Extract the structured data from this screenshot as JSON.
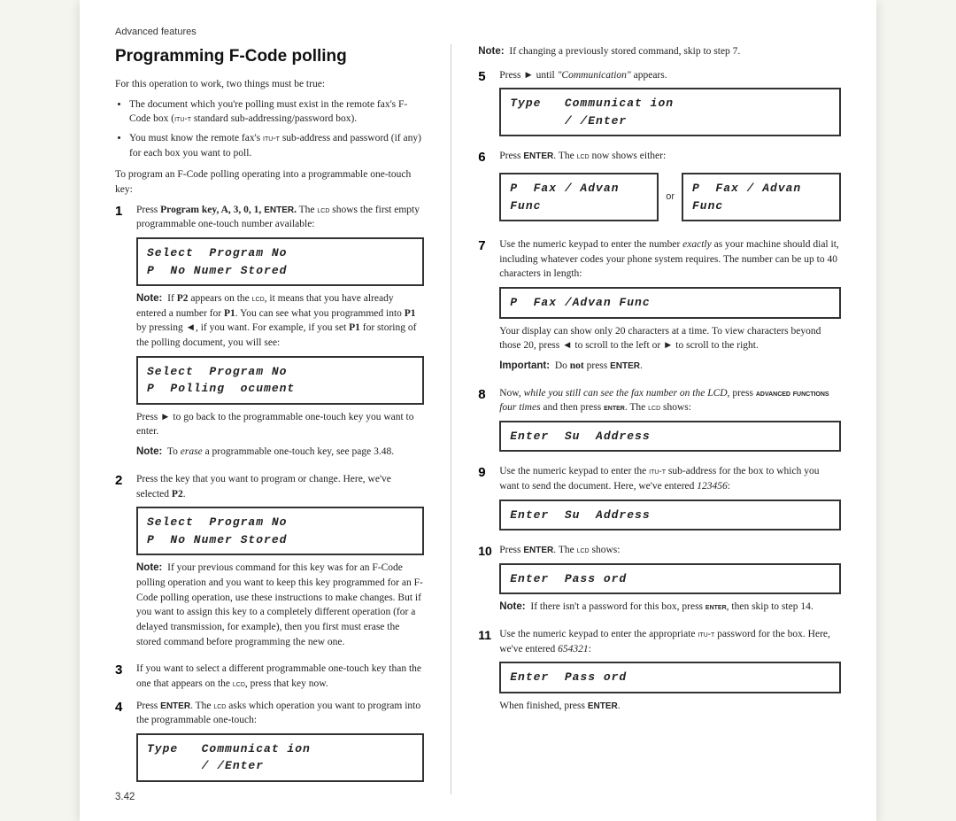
{
  "page": {
    "advanced_features_label": "Advanced features",
    "page_number": "3.42",
    "title": "Programming F-Code polling",
    "intro": "For this operation to work, two things must be true:",
    "bullets": [
      "The document which you're polling must exist in the remote fax's F-Code box (ITU-T standard sub-addressing/password box).",
      "You must know the remote fax's ITU-T sub-address and password (if any) for each box you want to poll."
    ],
    "to_program_text": "To program an F-Code polling operating into a programmable one-touch key:",
    "steps_left": [
      {
        "num": "1",
        "text": "Press Program key, A, 3, 0, 1, ENTER. The LCD shows the first empty programmable one-touch number available:",
        "lcd": [
          "Select  Program No",
          "P  No Numer Stored"
        ],
        "note": "If P2 appears on the LCD, it means that you have already entered a number for P1. You can see what you programmed into P1 by pressing ◄, if you want. For example, if you set P1 for storing of the polling document, you will see:",
        "note_lcd": [
          "Select  Program No",
          "P  Polling  ocument"
        ],
        "note_after": "Press ► to go back to the programmable one-touch key you want to enter.",
        "note2": "To erase a programmable one-touch key, see page 3.48."
      },
      {
        "num": "2",
        "text": "Press the key that you want to program or change. Here, we've selected P2.",
        "lcd": [
          "Select  Program No",
          "P  No Numer Stored"
        ],
        "note": "If your previous command for this key was for an F-Code polling operation and you want to keep this key programmed for an F-Code polling operation, use these instructions to make changes. But if you want to assign this key to a completely different operation (for a delayed transmission, for example), then you first must erase the stored command before programming the new one."
      },
      {
        "num": "3",
        "text": "If you want to select a different programmable one-touch key than the one that appears on the LCD, press that key now."
      },
      {
        "num": "4",
        "text": "Press ENTER. The LCD asks which operation you want to program into the programmable one-touch:",
        "lcd": [
          "Type   Communicat ion",
          "       / /Enter"
        ]
      }
    ],
    "steps_right": [
      {
        "num": "5",
        "note_top": "If changing a previously stored command, skip to step 7.",
        "text": "Press ► until \"Communication\" appears.",
        "lcd": [
          "Type   Communicat ion",
          "       / /Enter"
        ]
      },
      {
        "num": "6",
        "text": "Press ENTER. The LCD now shows either:",
        "lcd_left": [
          "P  Fax / Advan Func"
        ],
        "or_label": "or",
        "lcd_right": [
          "P  Fax / Advan Func"
        ]
      },
      {
        "num": "7",
        "text": "Use the numeric keypad to enter the number exactly as your machine should dial it, including whatever codes your phone system requires. The number can be up to 40 characters in length:",
        "lcd": [
          "P  Fax /Advan Func"
        ],
        "note_after": "Your display can show only 20 characters at a time. To view characters beyond those 20, press ◄ to scroll to the left or ► to scroll to the right.",
        "important": "Do not press ENTER."
      },
      {
        "num": "8",
        "text": "Now, while you still can see the fax number on the LCD, press ADVANCED FUNCTIONS four times and then press ENTER. The LCD shows:",
        "lcd": [
          "Enter  Su  Address"
        ]
      },
      {
        "num": "9",
        "text": "Use the numeric keypad to enter the ITU-T sub-address for the box to which you want to send the document. Here, we've entered 123456:",
        "lcd": [
          "Enter  Su  Address"
        ]
      },
      {
        "num": "10",
        "text": "Press ENTER. The LCD shows:",
        "lcd": [
          "Enter  Pass ord"
        ]
      },
      {
        "num": "11",
        "text": "Use the numeric keypad to enter the appropriate ITU-T password for the box. Here, we've entered 654321:",
        "lcd": [
          "Enter  Pass ord"
        ],
        "note_top": "If there isn't a password for this box, press ENTER, then skip to step 14.",
        "note_after": "When finished, press ENTER."
      }
    ]
  }
}
